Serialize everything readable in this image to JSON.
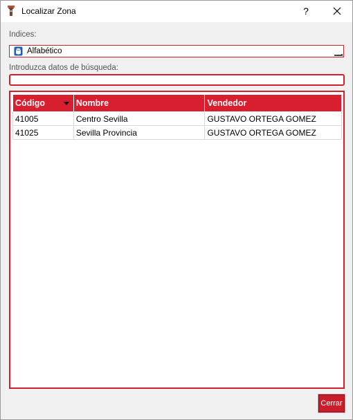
{
  "window": {
    "title": "Localizar Zona",
    "help_label": "?"
  },
  "indices": {
    "label": "Indices:",
    "selected": "Alfabético"
  },
  "search": {
    "label": "Introduzca datos de búsqueda:",
    "value": ""
  },
  "table": {
    "columns": [
      "Código",
      "Nombre",
      "Vendedor"
    ],
    "sorted_column": "Código",
    "rows": [
      [
        "41005",
        "Centro Sevilla",
        "GUSTAVO ORTEGA GOMEZ"
      ],
      [
        "41025",
        "Sevilla Provincia",
        "GUSTAVO ORTEGA GOMEZ"
      ]
    ]
  },
  "footer": {
    "close_label": "Cerrar"
  },
  "colors": {
    "accent": "#d81f2f",
    "border": "#d31f2d"
  },
  "icons": {
    "app": "flashlight-icon",
    "combo": "database-icon",
    "close": "close-icon",
    "sort": "sort-down-icon"
  }
}
